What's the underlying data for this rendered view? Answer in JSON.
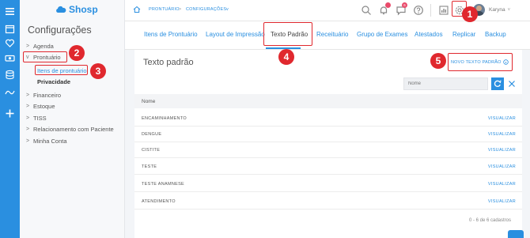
{
  "app": {
    "logo_text": "Shosp"
  },
  "sidebar": {
    "title": "Configurações",
    "items": [
      {
        "label": "Agenda",
        "chevron": ">"
      },
      {
        "label": "Prontuário",
        "chevron": "v"
      },
      {
        "label": "Financeiro",
        "chevron": ">"
      },
      {
        "label": "Estoque",
        "chevron": ">"
      },
      {
        "label": "TISS",
        "chevron": ">"
      },
      {
        "label": "Relacionamento com Paciente",
        "chevron": ">"
      },
      {
        "label": "Minha Conta",
        "chevron": ">"
      }
    ],
    "subitems": [
      {
        "label": "Itens de prontuário",
        "active": true
      },
      {
        "label": "Privacidade",
        "active": false
      }
    ]
  },
  "breadcrumb": {
    "item1": "PRONTUÁRIO",
    "sep": ">",
    "item2": "CONFIGURAÇÕES",
    "item2_suffix": "v"
  },
  "topbar": {
    "notif_badge": "",
    "chat_badge": "6",
    "user_name": "Karyna",
    "user_chevron": "v"
  },
  "tabs": [
    {
      "label": "Itens de Prontuário",
      "active": false
    },
    {
      "label": "Layout de Impressão",
      "active": false
    },
    {
      "label": "Texto Padrão",
      "active": true
    },
    {
      "label": "Receituário",
      "active": false
    },
    {
      "label": "Grupo de Exames",
      "active": false
    },
    {
      "label": "Atestados",
      "active": false
    },
    {
      "label": "Replicar",
      "active": false
    },
    {
      "label": "Backup",
      "active": false
    }
  ],
  "main": {
    "title": "Texto padrão",
    "new_button_label": "NOVO TEXTO PADRÃO",
    "search_placeholder": "Nome",
    "column_header": "Nome",
    "rows": [
      {
        "name": "ENCAMINHAMENTO",
        "action": "VISUALIZAR"
      },
      {
        "name": "DENGUE",
        "action": "VISUALIZAR"
      },
      {
        "name": "CISTITE",
        "action": "VISUALIZAR"
      },
      {
        "name": "TESTE",
        "action": "VISUALIZAR"
      },
      {
        "name": "TESTE ANAMNESE",
        "action": "VISUALIZAR"
      },
      {
        "name": "ATENDIMENTO",
        "action": "VISUALIZAR"
      }
    ],
    "count_text": "0 - 6 de 6 cadastros"
  },
  "annotations": [
    "1",
    "2",
    "3",
    "4",
    "5"
  ],
  "colors": {
    "brand": "#2a8fe0",
    "annotation": "#e0282e",
    "badge": "#e94b6b"
  }
}
